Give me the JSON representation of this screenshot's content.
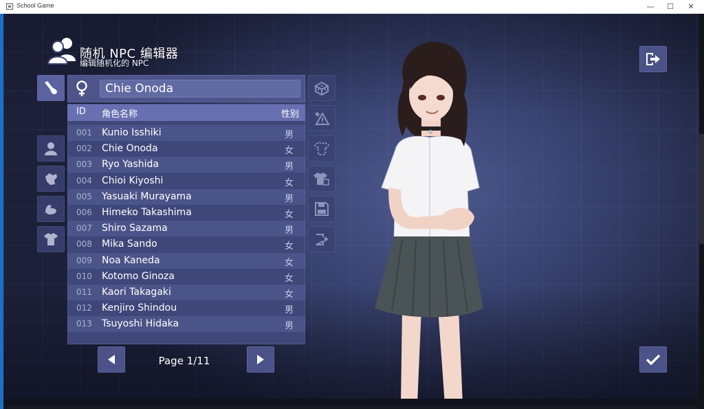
{
  "window": {
    "title": "School Game",
    "min": "—",
    "max": "☐",
    "close": "✕"
  },
  "header": {
    "title": "随机 NPC 编辑器",
    "subtitle": "编辑随机化的 NPC",
    "icon": "people-icon"
  },
  "character": {
    "name": "Chie Onoda",
    "gender_icon": "female-symbol"
  },
  "list": {
    "columns": {
      "id": "ID",
      "name": "角色名称",
      "gender": "性别"
    },
    "rows": [
      {
        "id": "001",
        "name": "Kunio Isshiki",
        "gender": "男"
      },
      {
        "id": "002",
        "name": "Chie Onoda",
        "gender": "女"
      },
      {
        "id": "003",
        "name": "Ryo Yashida",
        "gender": "男"
      },
      {
        "id": "004",
        "name": "Chioi Kiyoshi",
        "gender": "女"
      },
      {
        "id": "005",
        "name": "Yasuaki Murayama",
        "gender": "男"
      },
      {
        "id": "006",
        "name": "Himeko Takashima",
        "gender": "女"
      },
      {
        "id": "007",
        "name": "Shiro Sazama",
        "gender": "男"
      },
      {
        "id": "008",
        "name": "Mika Sando",
        "gender": "女"
      },
      {
        "id": "009",
        "name": "Noa Kaneda",
        "gender": "女"
      },
      {
        "id": "010",
        "name": "Kotomo Ginoza",
        "gender": "女"
      },
      {
        "id": "011",
        "name": "Kaori Takagaki",
        "gender": "女"
      },
      {
        "id": "012",
        "name": "Kenjiro Shindou",
        "gender": "男"
      },
      {
        "id": "013",
        "name": "Tsuyoshi Hidaka",
        "gender": "男"
      }
    ]
  },
  "pagination": {
    "label": "Page 1/11",
    "current": 1,
    "total": 11
  },
  "left_tools": [
    "paint-brush-icon",
    "person-icon",
    "hand-icon",
    "muscle-arm-icon",
    "shirt-icon"
  ],
  "right_tools": [
    "dice-icon",
    "warning-icon",
    "outfit-outline-icon",
    "shirt-tag-icon",
    "save-disk-icon",
    "load-icon"
  ],
  "corner_buttons": {
    "exit": "exit-door-icon",
    "confirm": "checkmark-icon"
  },
  "colors": {
    "panel": "#4c5489",
    "list_bg": "#3f4779",
    "header_row": "#6970b1",
    "accent_text": "#ffffff"
  }
}
